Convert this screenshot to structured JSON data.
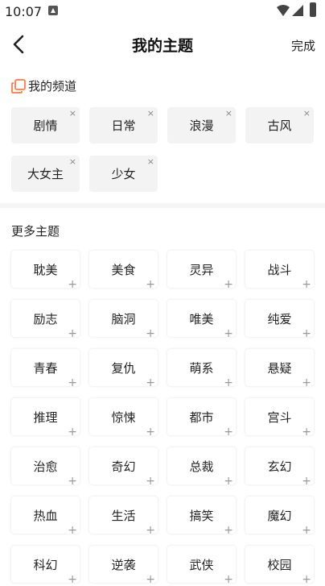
{
  "status_bar": {
    "time": "10:07"
  },
  "header": {
    "title": "我的主题",
    "done_label": "完成"
  },
  "my_channels": {
    "title": "我的频道",
    "remove_glyph": "×",
    "items": [
      "剧情",
      "日常",
      "浪漫",
      "古风",
      "大女主",
      "少女"
    ]
  },
  "more_topics": {
    "title": "更多主题",
    "add_glyph": "+",
    "items": [
      "耽美",
      "美食",
      "灵异",
      "战斗",
      "励志",
      "脑洞",
      "唯美",
      "纯爱",
      "青春",
      "复仇",
      "萌系",
      "悬疑",
      "推理",
      "惊悚",
      "都市",
      "宫斗",
      "治愈",
      "奇幻",
      "总裁",
      "玄幻",
      "热血",
      "生活",
      "搞笑",
      "魔幻",
      "科幻",
      "逆袭",
      "武侠",
      "校园"
    ]
  },
  "colors": {
    "accent": "#ff7a45",
    "chip_bg": "#f3f3f3",
    "divider": "#f5f5f5"
  }
}
